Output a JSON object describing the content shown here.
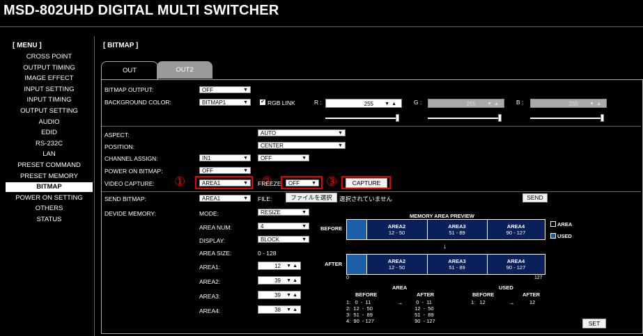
{
  "app": {
    "title": "MSD-802UHD DIGITAL MULTI SWITCHER"
  },
  "menu": {
    "header": "[ MENU ]",
    "items": [
      "CROSS POINT",
      "OUTPUT TIMING",
      "IMAGE EFFECT",
      "INPUT SETTING",
      "INPUT TIMING",
      "OUTPUT SETTING",
      "AUDIO",
      "EDID",
      "RS-232C",
      "LAN",
      "PRESET COMMAND",
      "PRESET MEMORY",
      "BITMAP",
      "POWER ON SETTING",
      "OTHERS",
      "STATUS"
    ],
    "active_index": 12
  },
  "section": {
    "title": "[ BITMAP ]"
  },
  "tabs": [
    "OUT",
    "OUT2"
  ],
  "form": {
    "bitmap_output": {
      "label": "BITMAP OUTPUT:",
      "value": "OFF"
    },
    "background_color": {
      "label": "BACKGROUND COLOR:",
      "value": "BITMAP1",
      "rgb_link": "RGB LINK",
      "rgb_checked": true,
      "r": {
        "label": "R :",
        "value": "255"
      },
      "g": {
        "label": "G :",
        "value": "255"
      },
      "b": {
        "label": "B :",
        "value": "255"
      }
    },
    "aspect": {
      "label": "ASPECT:",
      "value": "AUTO"
    },
    "position": {
      "label": "POSITION:",
      "value": "CENTER"
    },
    "channel_assign": {
      "label": "CHANNEL ASSIGN:",
      "value1": "IN1",
      "value2": "OFF"
    },
    "power_on_bitmap": {
      "label": "POWER ON BITMAP:",
      "value": "OFF"
    },
    "video_capture": {
      "label": "VIDEO CAPTURE:",
      "value": "AREA1",
      "freeze_label": "FREEZE:",
      "freeze_value": "OFF",
      "capture_button": "CAPTURE"
    },
    "send_bitmap": {
      "label": "SEND BITMAP:",
      "value": "AREA1",
      "file_label": "FILE:",
      "file_button": "ファイルを選択",
      "file_status": "選択されていません",
      "send_button": "SEND"
    },
    "devide_memory": {
      "label": "DEVIDE MEMORY:",
      "mode": {
        "label": "MODE:",
        "value": "RESIZE"
      },
      "area_num": {
        "label": "AREA NUM:",
        "value": "4"
      },
      "display": {
        "label": "DISPLAY:",
        "value": "BLOCK"
      },
      "area_size": {
        "label": "AREA SIZE:",
        "value": "0 - 128"
      },
      "areas": [
        {
          "label": "AREA1:",
          "value": "12"
        },
        {
          "label": "AREA2:",
          "value": "39"
        },
        {
          "label": "AREA3:",
          "value": "39"
        },
        {
          "label": "AREA4:",
          "value": "38"
        }
      ]
    }
  },
  "annotations": {
    "c1": "①",
    "c2": "②",
    "c3": "③"
  },
  "preview": {
    "title": "MEMORY AREA PREVIEW",
    "before_label": "BEFORE",
    "after_label": "AFTER",
    "before_cells": [
      {
        "name": "AREA2",
        "range": "12 - 50"
      },
      {
        "name": "AREA3",
        "range": "51 - 89"
      },
      {
        "name": "AREA4",
        "range": "90 - 127"
      }
    ],
    "after_cells": [
      {
        "name": "AREA2",
        "range": "12 - 50"
      },
      {
        "name": "AREA3",
        "range": "51 - 89"
      },
      {
        "name": "AREA4",
        "range": "90 - 127"
      }
    ],
    "down_arrow": "↓",
    "scale_min": "0",
    "scale_max": "127",
    "legend_area": "AREA",
    "legend_used": "USED"
  },
  "stats": {
    "area_title": "AREA",
    "used_title": "USED",
    "before": "BEFORE",
    "after": "AFTER",
    "area_before": "1:   0  -  11\n2:  12  -  50\n3:  51  -  89\n4:  90  - 127",
    "area_arrow": "→",
    "area_after": "  0  -  11\n 12  -  50\n 51  -  89\n 90  - 127",
    "used_before": "1:   12",
    "used_arrow": "→",
    "used_after": "12"
  },
  "set_button": "SET",
  "colors": {
    "accent_red": "#e00000",
    "preview_blue": "#1c5fa8",
    "active_menu_bg": "#ffffff"
  }
}
